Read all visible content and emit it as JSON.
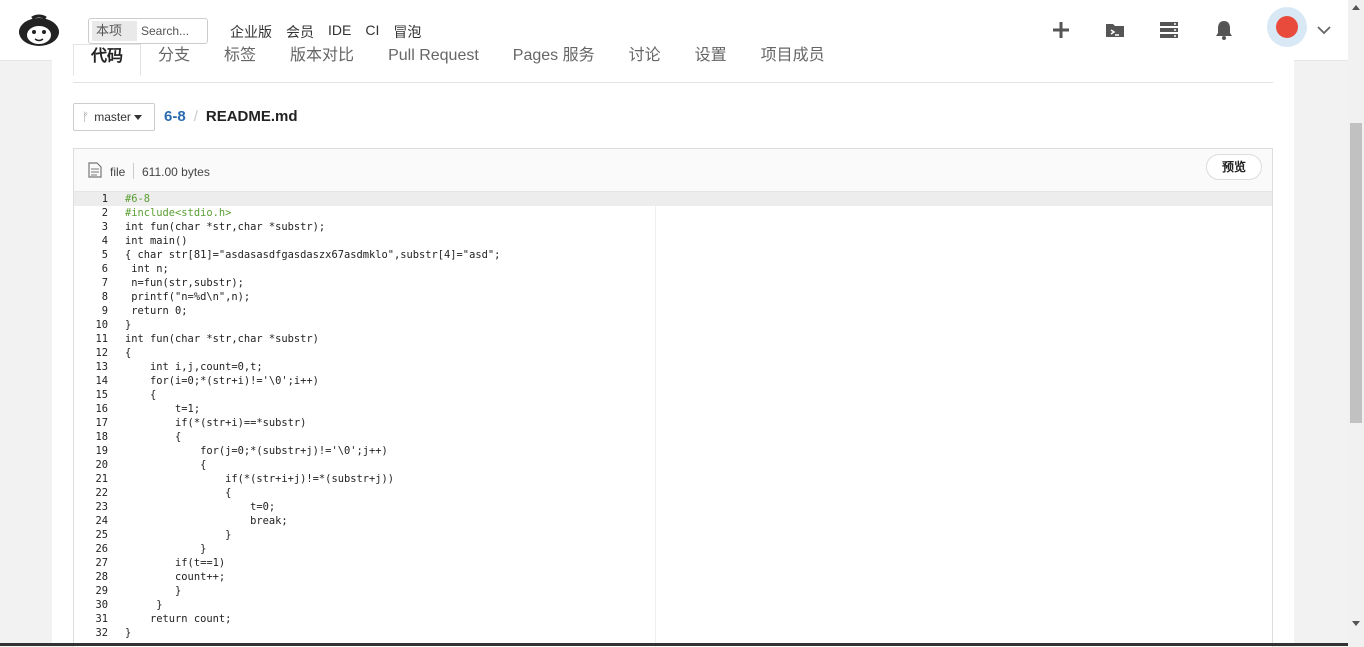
{
  "header": {
    "search_scope": "本项目",
    "search_placeholder": "Search...",
    "nav": [
      "企业版",
      "会员",
      "IDE",
      "CI",
      "冒泡"
    ],
    "icons": [
      "plus-icon",
      "terminal-folder-icon",
      "server-icon",
      "bell-icon"
    ],
    "avatar_color": "#e84b3c"
  },
  "tabs": [
    "代码",
    "分支",
    "标签",
    "版本对比",
    "Pull Request",
    "Pages 服务",
    "讨论",
    "设置",
    "项目成员"
  ],
  "breadcrumb": {
    "branch": "master",
    "repo": "6-8",
    "separator": "/",
    "file": "README.md"
  },
  "file": {
    "type": "file",
    "size": "611.00 bytes",
    "preview_label": "预览"
  },
  "code_lines": [
    {
      "n": "1",
      "t": "#6-8"
    },
    {
      "n": "2",
      "t": "#include<stdio.h>"
    },
    {
      "n": "3",
      "t": "int fun(char *str,char *substr);"
    },
    {
      "n": "4",
      "t": "int main()"
    },
    {
      "n": "5",
      "t": "{ char str[81]=\"asdasasdfgasdaszx67asdmklo\",substr[4]=\"asd\";"
    },
    {
      "n": "6",
      "t": " int n;"
    },
    {
      "n": "7",
      "t": " n=fun(str,substr);"
    },
    {
      "n": "8",
      "t": " printf(\"n=%d\\n\",n);"
    },
    {
      "n": "9",
      "t": " return 0;"
    },
    {
      "n": "10",
      "t": "}"
    },
    {
      "n": "11",
      "t": "int fun(char *str,char *substr)"
    },
    {
      "n": "12",
      "t": "{"
    },
    {
      "n": "13",
      "t": "    int i,j,count=0,t;"
    },
    {
      "n": "14",
      "t": "    for(i=0;*(str+i)!='\\0';i++)"
    },
    {
      "n": "15",
      "t": "    {"
    },
    {
      "n": "16",
      "t": "        t=1;"
    },
    {
      "n": "17",
      "t": "        if(*(str+i)==*substr)"
    },
    {
      "n": "18",
      "t": "        {"
    },
    {
      "n": "19",
      "t": "            for(j=0;*(substr+j)!='\\0';j++)"
    },
    {
      "n": "20",
      "t": "            {"
    },
    {
      "n": "21",
      "t": "                if(*(str+i+j)!=*(substr+j))"
    },
    {
      "n": "22",
      "t": "                {"
    },
    {
      "n": "23",
      "t": "                    t=0;"
    },
    {
      "n": "24",
      "t": "                    break;"
    },
    {
      "n": "25",
      "t": "                }"
    },
    {
      "n": "26",
      "t": "            }"
    },
    {
      "n": "27",
      "t": "        if(t==1)"
    },
    {
      "n": "28",
      "t": "        count++;"
    },
    {
      "n": "29",
      "t": "        }"
    },
    {
      "n": "30",
      "t": "     }"
    },
    {
      "n": "31",
      "t": "    return count;"
    },
    {
      "n": "32",
      "t": "}"
    }
  ]
}
